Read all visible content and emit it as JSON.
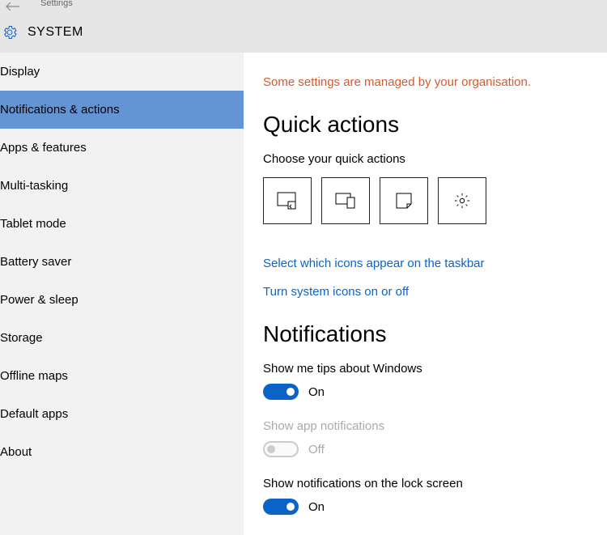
{
  "header": {
    "breadcrumb": "Settings",
    "title": "SYSTEM"
  },
  "sidebar": {
    "items": [
      {
        "label": "Display"
      },
      {
        "label": "Notifications & actions"
      },
      {
        "label": "Apps & features"
      },
      {
        "label": "Multi-tasking"
      },
      {
        "label": "Tablet mode"
      },
      {
        "label": "Battery saver"
      },
      {
        "label": "Power & sleep"
      },
      {
        "label": "Storage"
      },
      {
        "label": "Offline maps"
      },
      {
        "label": "Default apps"
      },
      {
        "label": "About"
      }
    ],
    "selected_index": 1
  },
  "main": {
    "managed_warning": "Some settings are managed by your organisation.",
    "quick_actions": {
      "heading": "Quick actions",
      "sub": "Choose your quick actions",
      "tiles": [
        "tablet-mode-icon",
        "connect-icon",
        "note-icon",
        "all-settings-icon"
      ],
      "link1": "Select which icons appear on the taskbar",
      "link2": "Turn system icons on or off"
    },
    "notifications": {
      "heading": "Notifications",
      "toggles": [
        {
          "label": "Show me tips about Windows",
          "state": "On",
          "on": true,
          "disabled": false
        },
        {
          "label": "Show app notifications",
          "state": "Off",
          "on": false,
          "disabled": true
        },
        {
          "label": "Show notifications on the lock screen",
          "state": "On",
          "on": true,
          "disabled": false
        }
      ]
    }
  }
}
